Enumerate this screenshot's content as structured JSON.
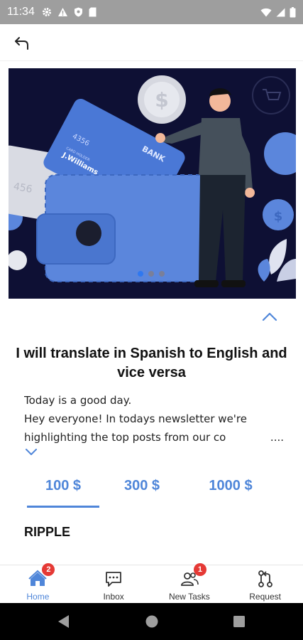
{
  "status_bar": {
    "time": "11:34",
    "icons": [
      "gear-icon",
      "warning-icon",
      "shield-icon",
      "sd-card-icon"
    ],
    "right_icons": [
      "wifi-icon",
      "signal-icon",
      "battery-icon"
    ]
  },
  "app_bar": {
    "back_icon": "back-arrow-icon"
  },
  "banner": {
    "illustration": "wallet-bank-card-man",
    "card_text": {
      "bank": "BANK",
      "number": "4356",
      "holder_label": "CARD HOLDER",
      "holder": "J.Williams",
      "back_number": "456"
    },
    "slide_count": 3,
    "active_slide": 0,
    "colors": {
      "background": "#0e1034",
      "wallet": "#5b86dc",
      "accent": "#2f78f0"
    }
  },
  "gig": {
    "title": "I will translate in Spanish to English and vice versa",
    "description_lines": [
      "Today is a good day.",
      "Hey everyone! In todays newsletter we're",
      "highlighting the top posts from our co"
    ],
    "ellipsis": "....",
    "collapse_icon": "chevron-up-icon",
    "expand_icon": "chevron-down-icon"
  },
  "pricing": {
    "options": [
      "100 $",
      "300 $",
      "1000 $"
    ],
    "selected_index": 0,
    "accent_color": "#4f86d9"
  },
  "section": {
    "label": "RIPPLE"
  },
  "bottom_nav": {
    "items": [
      {
        "label": "Home",
        "icon": "home-icon",
        "badge": "2",
        "active": true
      },
      {
        "label": "Inbox",
        "icon": "chat-icon",
        "badge": "",
        "active": false
      },
      {
        "label": "New Tasks",
        "icon": "users-icon",
        "badge": "1",
        "active": false
      },
      {
        "label": "Request",
        "icon": "pull-request-icon",
        "badge": "",
        "active": false
      }
    ]
  },
  "system_nav": {
    "icons": [
      "back-triangle-icon",
      "home-circle-icon",
      "recents-square-icon"
    ]
  }
}
